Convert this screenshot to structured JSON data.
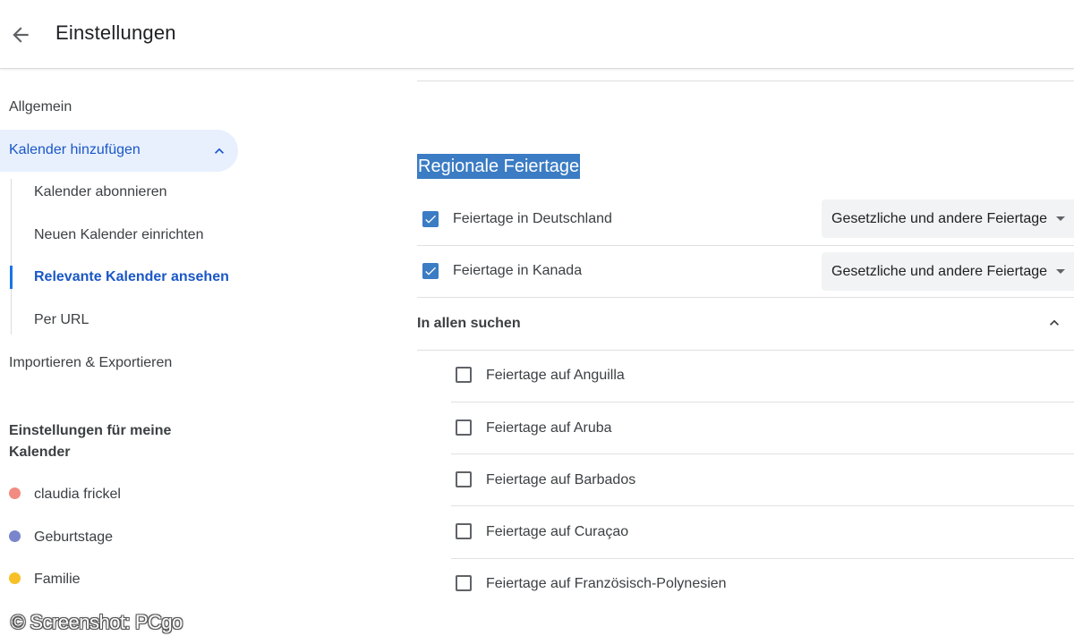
{
  "header": {
    "back_icon": "arrow-left-icon",
    "title": "Einstellungen"
  },
  "sidebar": {
    "general": "Allgemein",
    "add_calendar": {
      "label": "Kalender hinzufügen",
      "expanded": true,
      "items": [
        {
          "label": "Kalender abonnieren",
          "active": false
        },
        {
          "label": "Neuen Kalender einrichten",
          "active": false
        },
        {
          "label": "Relevante Kalender ansehen",
          "active": true
        },
        {
          "label": "Per URL",
          "active": false
        }
      ]
    },
    "import_export": "Importieren & Exportieren",
    "my_calendars_heading": "Einstellungen für meine Kalender",
    "my_calendars": [
      {
        "name": "claudia frickel",
        "color": "#f28b82"
      },
      {
        "name": "Geburtstage",
        "color": "#7986cb"
      },
      {
        "name": "Familie",
        "color": "#f6c026"
      }
    ]
  },
  "main": {
    "section_title": "Regionale Feiertage",
    "selected_holidays": [
      {
        "label": "Feiertage in Deutschland",
        "checked": true,
        "option": "Gesetzliche und andere Feiertage"
      },
      {
        "label": "Feiertage in Kanada",
        "checked": true,
        "option": "Gesetzliche und andere Feiertage"
      }
    ],
    "search_all_label": "In allen suchen",
    "search_results": [
      {
        "label": "Feiertage auf Anguilla",
        "checked": false
      },
      {
        "label": "Feiertage auf Aruba",
        "checked": false
      },
      {
        "label": "Feiertage auf Barbados",
        "checked": false
      },
      {
        "label": "Feiertage auf Curaçao",
        "checked": false
      },
      {
        "label": "Feiertage auf Französisch-Polynesien",
        "checked": false
      }
    ]
  },
  "watermark": "© Screenshot: PCgo",
  "colors": {
    "accent": "#1a73e8",
    "active_text": "#1a57c7",
    "active_bg": "#e8f0fe",
    "checkbox": "#3b7cc4",
    "highlight": "#3b7cc4"
  }
}
